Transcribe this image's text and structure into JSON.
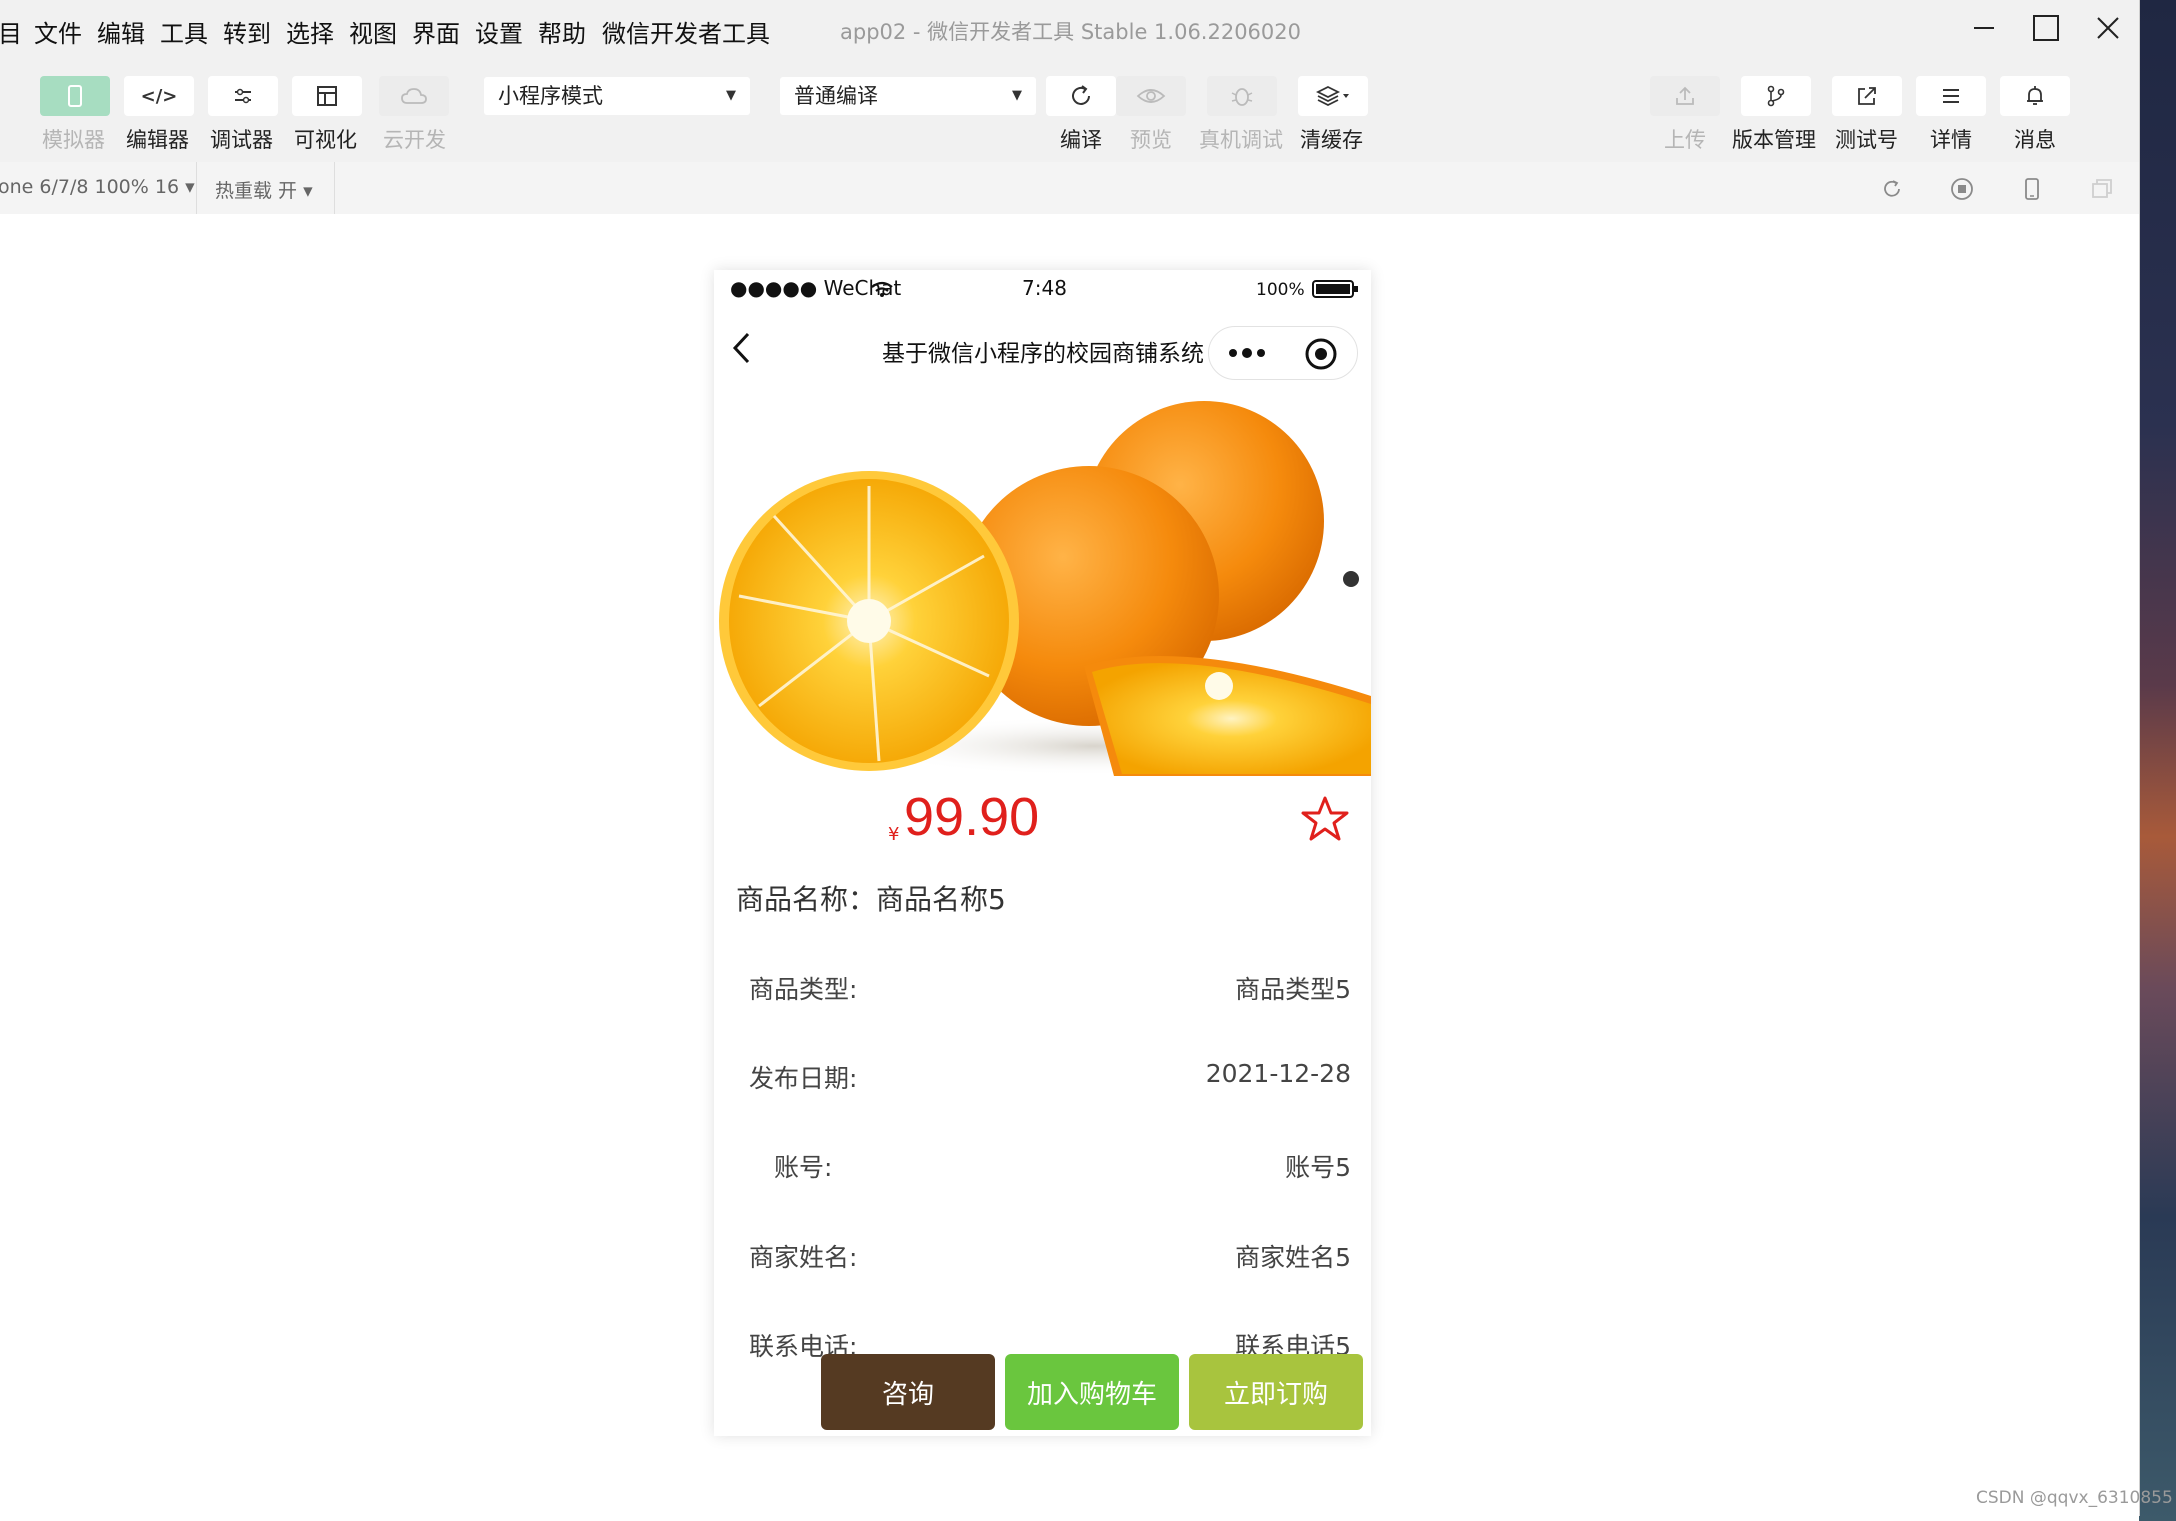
{
  "menu": [
    "目",
    "文件",
    "编辑",
    "工具",
    "转到",
    "选择",
    "视图",
    "界面",
    "设置",
    "帮助",
    "微信开发者工具"
  ],
  "app_title": "app02 - 微信开发者工具 Stable 1.06.2206020",
  "toolbar": {
    "simulator": "模拟器",
    "editor": "编辑器",
    "debugger": "调试器",
    "visual": "可视化",
    "cloud": "云开发",
    "mode_select": "小程序模式",
    "compile_select": "普通编译",
    "compile": "编译",
    "preview": "预览",
    "real_debug": "真机调试",
    "clear_cache": "清缓存",
    "upload": "上传",
    "version": "版本管理",
    "test_account": "测试号",
    "details": "详情",
    "messages": "消息"
  },
  "subbar": {
    "device": "one 6/7/8 100% 16 ▾",
    "hot_reload": "热重载 开 ▾"
  },
  "phone": {
    "carrier": "●●●●● WeChat",
    "time": "7:48",
    "battery": "100%",
    "nav_title": "基于微信小程序的校园商铺系统",
    "price_symbol": "¥",
    "price": "99.90",
    "goods_name": "商品名称：商品名称5",
    "info": [
      {
        "label": "商品类型:",
        "value": "商品类型5"
      },
      {
        "label": "发布日期:",
        "value": "2021-12-28"
      },
      {
        "label": "账号:",
        "value": "账号5"
      },
      {
        "label": "商家姓名:",
        "value": "商家姓名5"
      },
      {
        "label": "联系电话:",
        "value": "联系电话5"
      }
    ],
    "buttons": {
      "consult": "咨询",
      "add_cart": "加入购物车",
      "buy_now": "立即订购"
    },
    "colors": {
      "price": "#e0201c",
      "consult": "#553a22",
      "add_cart": "#6ac63e",
      "buy_now": "#a8c43e"
    }
  },
  "watermark": "CSDN @qqvx_6310855"
}
